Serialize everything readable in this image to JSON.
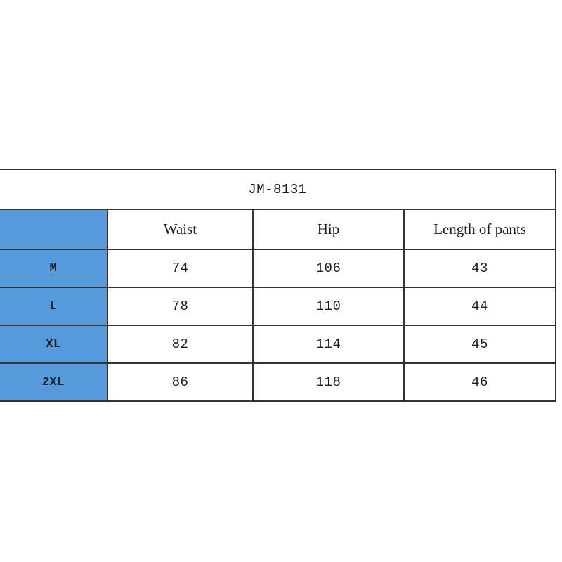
{
  "chart": {
    "title": "JM-8131",
    "accent_color": "#559bdb",
    "border_color": "#333333",
    "text_color": "#1b1b1b",
    "size_header_label": "",
    "columns": [
      {
        "key": "size",
        "label": ""
      },
      {
        "key": "waist",
        "label": "Waist"
      },
      {
        "key": "hip",
        "label": "Hip"
      },
      {
        "key": "length",
        "label": "Length of pants"
      }
    ],
    "rows": [
      {
        "size": "M",
        "waist": "74",
        "hip": "106",
        "length": "43"
      },
      {
        "size": "L",
        "waist": "78",
        "hip": "110",
        "length": "44"
      },
      {
        "size": "XL",
        "waist": "82",
        "hip": "114",
        "length": "45"
      },
      {
        "size": "2XL",
        "waist": "86",
        "hip": "118",
        "length": "46"
      }
    ]
  }
}
